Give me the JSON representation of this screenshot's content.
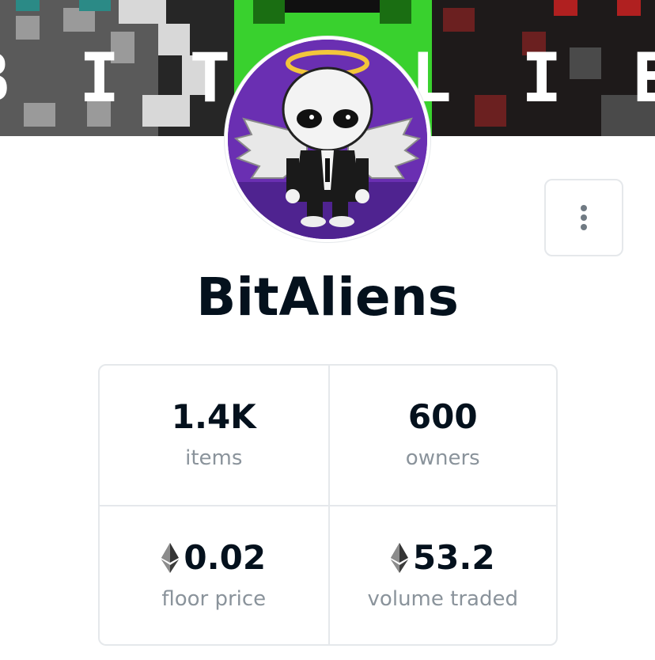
{
  "banner": {
    "text": "BITALIENS",
    "icon": "pixel-art-banner"
  },
  "collection": {
    "name": "BitAliens",
    "avatar_icon": "angel-alien-avatar"
  },
  "more_button": {
    "icon": "vertical-dots-icon"
  },
  "stats": [
    {
      "value": "1.4K",
      "label": "items",
      "icon": null
    },
    {
      "value": "600",
      "label": "owners",
      "icon": null
    },
    {
      "value": "0.02",
      "label": "floor price",
      "icon": "ethereum-icon"
    },
    {
      "value": "53.2",
      "label": "volume traded",
      "icon": "ethereum-icon"
    }
  ],
  "colors": {
    "text": "#04111d",
    "muted": "#8a939b",
    "border": "#e5e8eb",
    "avatar_bg": "#6a2fb2",
    "banner_green": "#39d12e"
  }
}
